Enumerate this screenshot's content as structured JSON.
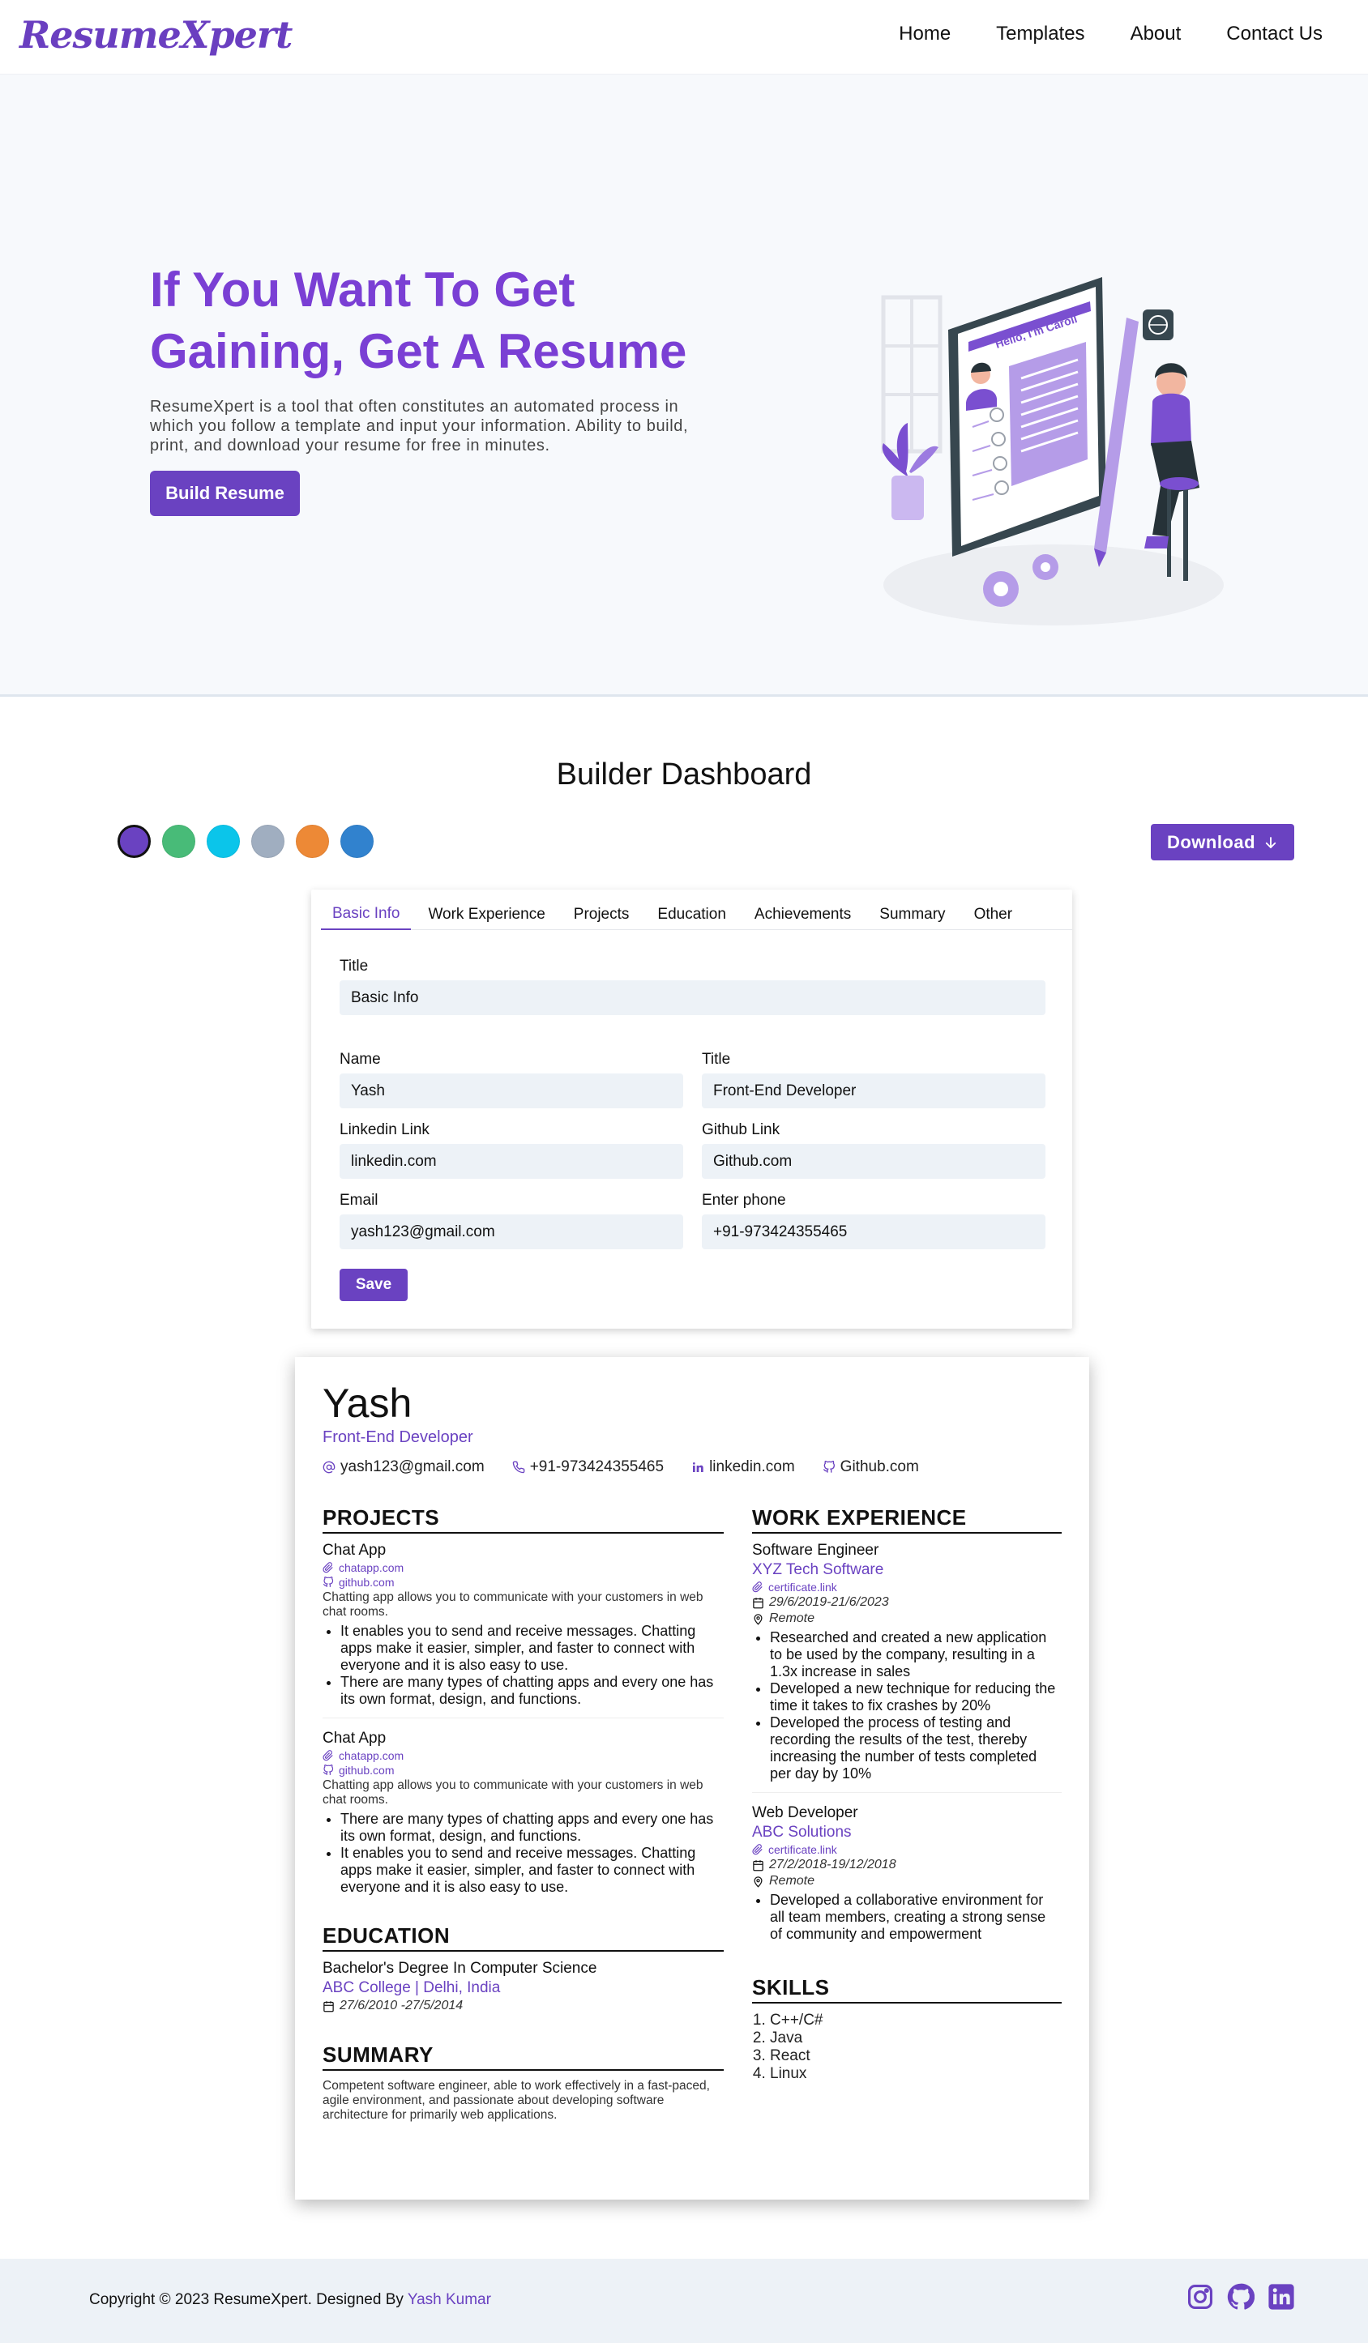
{
  "nav": {
    "logo": "ResumeXpert",
    "links": [
      "Home",
      "Templates",
      "About",
      "Contact Us"
    ]
  },
  "hero": {
    "title": "If You Want To Get Gaining, Get A Resume",
    "description": "ResumeXpert is a tool that often constitutes an automated process in which you follow a template and input your information. Ability to build, print, and download your resume for free in minutes.",
    "button": "Build Resume",
    "illustration_text": "Hello, I'm Caroll"
  },
  "dashboard": {
    "title": "Builder Dashboard",
    "swatches": [
      "#6a42c1",
      "#48bb78",
      "#0bc5ea",
      "#a0aec0",
      "#ed8936",
      "#3182ce"
    ],
    "active_swatch": 0,
    "download": "Download"
  },
  "editor": {
    "tabs": [
      "Basic Info",
      "Work Experience",
      "Projects",
      "Education",
      "Achievements",
      "Summary",
      "Other"
    ],
    "active_tab": "Basic Info",
    "section_title_label": "Title",
    "section_title_value": "Basic Info",
    "name_label": "Name",
    "name_value": "Yash",
    "title_label": "Title",
    "title_value": "Front-End Developer",
    "linkedin_label": "Linkedin Link",
    "linkedin_value": "linkedin.com",
    "github_label": "Github Link",
    "github_value": "Github.com",
    "email_label": "Email",
    "email_value": "yash123@gmail.com",
    "phone_label": "Enter phone",
    "phone_value": "+91-973424355465",
    "save": "Save"
  },
  "resume": {
    "name": "Yash",
    "role": "Front-End Developer",
    "email": "yash123@gmail.com",
    "phone": "+91-973424355465",
    "linkedin": "linkedin.com",
    "github": "Github.com",
    "projects_heading": "PROJECTS",
    "projects": [
      {
        "title": "Chat App",
        "deployed": "chatapp.com",
        "repo": "github.com",
        "description": "Chatting app allows you to communicate with your customers in web chat rooms.",
        "points": [
          "It enables you to send and receive messages. Chatting apps make it easier, simpler, and faster to connect with everyone and it is also easy to use.",
          "There are many types of chatting apps and every one has its own format, design, and functions."
        ]
      },
      {
        "title": "Chat App",
        "deployed": "chatapp.com",
        "repo": "github.com",
        "description": "Chatting app allows you to communicate with your customers in web chat rooms.",
        "points": [
          "There are many types of chatting apps and every one has its own format, design, and functions.",
          "It enables you to send and receive messages. Chatting apps make it easier, simpler, and faster to connect with everyone and it is also easy to use."
        ]
      }
    ],
    "education_heading": "EDUCATION",
    "education": {
      "degree": "Bachelor's Degree In Computer Science",
      "college": "ABC College | Delhi, India",
      "dates": "27/6/2010 -27/5/2014"
    },
    "summary_heading": "SUMMARY",
    "summary": "Competent software engineer, able to work effectively in a fast-paced, agile environment, and passionate about developing software architecture for primarily web applications.",
    "work_heading": "WORK EXPERIENCE",
    "work": [
      {
        "title": "Software Engineer",
        "company": "XYZ Tech Software",
        "certificate": "certificate.link",
        "dates": "29/6/2019-21/6/2023",
        "location": "Remote",
        "points": [
          "Researched and created a new application to be used by the company, resulting in a 1.3x increase in sales",
          "Developed a new technique for reducing the time it takes to fix crashes by 20%",
          "Developed the process of testing and recording the results of the test, thereby increasing the number of tests completed per day by 10%"
        ]
      },
      {
        "title": "Web Developer",
        "company": "ABC Solutions",
        "certificate": "certificate.link",
        "dates": "27/2/2018-19/12/2018",
        "location": "Remote",
        "points": [
          "Developed a collaborative environment for all team members, creating a strong sense of community and empowerment"
        ]
      }
    ],
    "skills_heading": "SKILLS",
    "skills": [
      "C++/C#",
      "Java",
      "React",
      "Linux"
    ]
  },
  "footer": {
    "copyright": "Copyright © 2023 ResumeXpert. Designed By",
    "author": "Yash Kumar",
    "socials": [
      "instagram-icon",
      "github-icon",
      "linkedin-icon"
    ]
  }
}
